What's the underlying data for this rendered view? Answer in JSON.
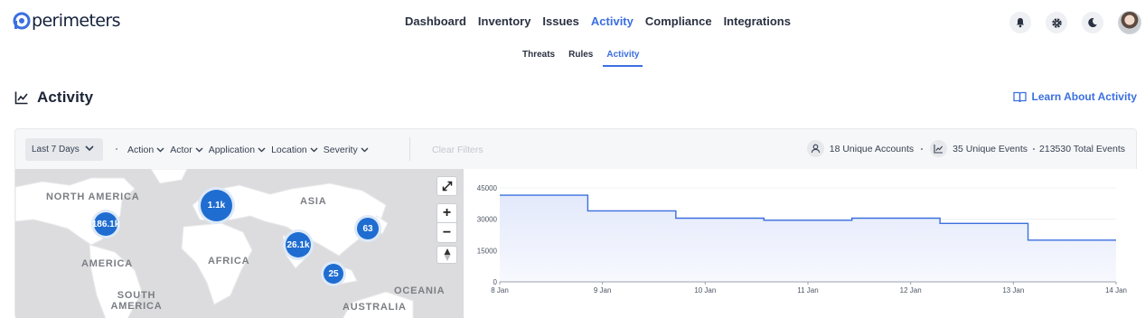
{
  "brand": {
    "name": "perimeters",
    "accent": "#3b6fe0"
  },
  "main_nav": [
    {
      "label": "Dashboard",
      "active": false
    },
    {
      "label": "Inventory",
      "active": false
    },
    {
      "label": "Issues",
      "active": false
    },
    {
      "label": "Activity",
      "active": true
    },
    {
      "label": "Compliance",
      "active": false
    },
    {
      "label": "Integrations",
      "active": false
    }
  ],
  "header_icons": [
    "bell-icon",
    "gear-icon",
    "moon-icon"
  ],
  "sub_nav": [
    {
      "label": "Threats",
      "active": false
    },
    {
      "label": "Rules",
      "active": false
    },
    {
      "label": "Activity",
      "active": true
    }
  ],
  "page": {
    "title": "Activity",
    "learn_link": "Learn About Activity"
  },
  "filter_bar": {
    "range": "Last 7 Days",
    "filters": [
      "Action",
      "Actor",
      "Application",
      "Location",
      "Severity"
    ],
    "clear": "Clear Filters",
    "stats": {
      "accounts": "18 Unique Accounts",
      "events": "35 Unique Events",
      "total": "213530 Total Events"
    }
  },
  "map": {
    "labels": {
      "north_america": "NORTH AMERICA",
      "asia": "ASIA",
      "africa": "AFRICA",
      "america": "AMERICA",
      "south_america": "SOUTH AMERICA",
      "oceania": "OCEANIA",
      "australia": "AUSTRALIA"
    },
    "clusters": {
      "na": "186.1k",
      "europe": "1.1k",
      "india": "26.1k",
      "east_asia": "63",
      "sea": "25"
    },
    "controls": {
      "zoom_in": "+",
      "zoom_out": "−"
    }
  },
  "chart_data": {
    "type": "area",
    "step": true,
    "x": [
      "8 Jan",
      "9 Jan",
      "10 Jan",
      "11 Jan",
      "12 Jan",
      "13 Jan",
      "14 Jan"
    ],
    "values": [
      41500,
      34000,
      30500,
      29500,
      30500,
      28000,
      20000
    ],
    "yticks": [
      0,
      15000,
      30000,
      45000
    ],
    "ytick_labels": [
      "0",
      "15000",
      "30000",
      "45000"
    ],
    "ylim": [
      0,
      45000
    ],
    "line_color": "#3b6fe0",
    "fill_color": "#e3e9fb"
  }
}
